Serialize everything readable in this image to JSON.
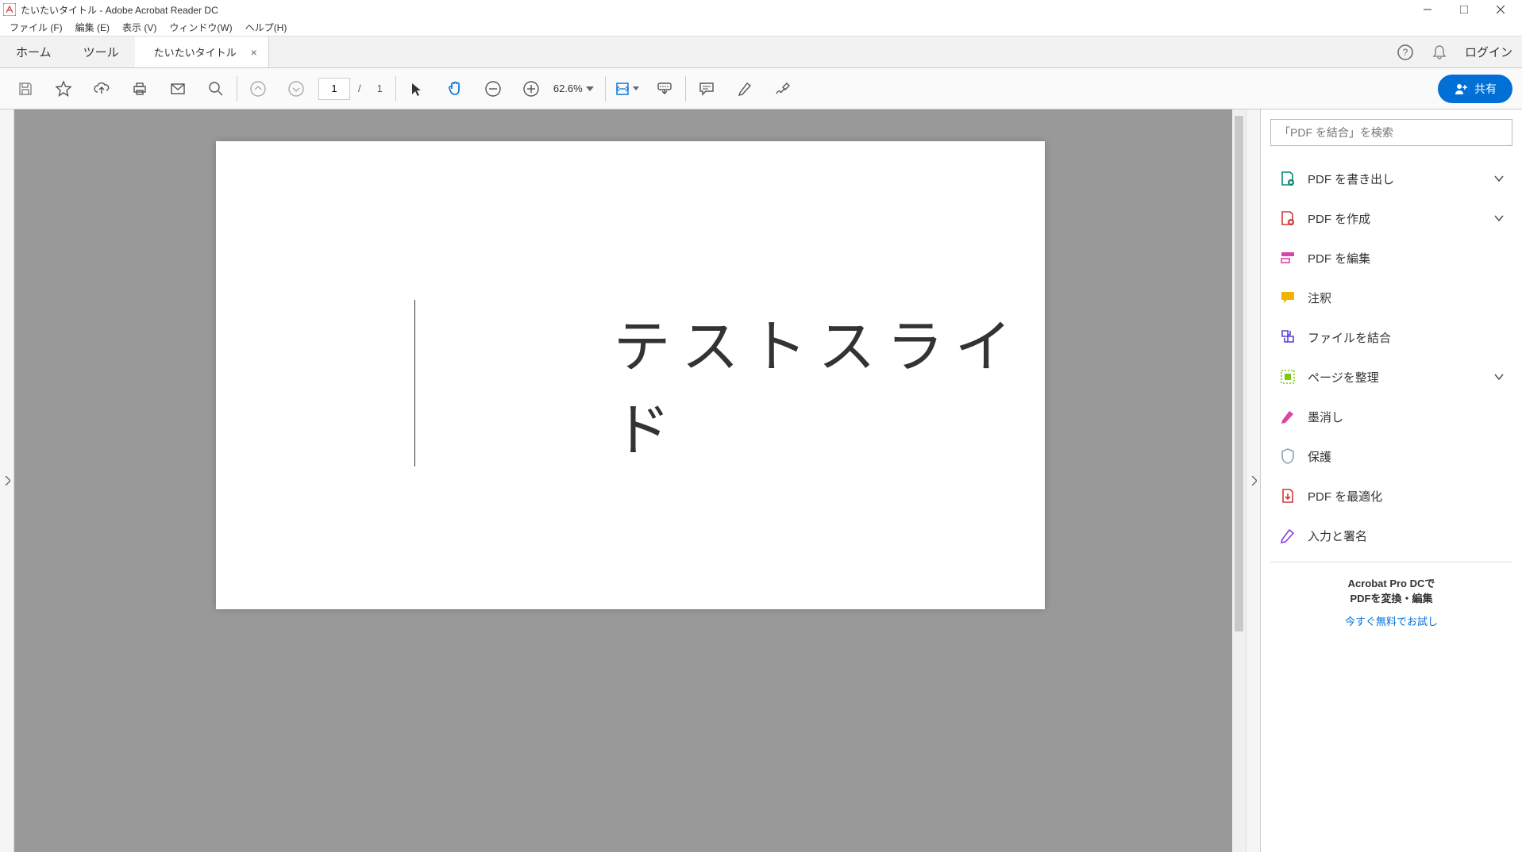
{
  "window": {
    "title": "たいたいタイトル - Adobe Acrobat Reader DC"
  },
  "menubar": {
    "file": "ファイル (F)",
    "edit": "編集 (E)",
    "view": "表示 (V)",
    "window": "ウィンドウ(W)",
    "help": "ヘルプ(H)"
  },
  "tabs": {
    "home": "ホーム",
    "tools": "ツール",
    "doc": "たいたいタイトル",
    "login": "ログイン"
  },
  "toolbar": {
    "page_current": "1",
    "page_sep": "/",
    "page_total": "1",
    "zoom": "62.6%",
    "share": "共有"
  },
  "document": {
    "slide_text": "テストスライド"
  },
  "rightpanel": {
    "search_placeholder": "「PDF を結合」を検索",
    "tools": [
      {
        "label": "PDF を書き出し",
        "chevron": true,
        "color": "#0b8a6f"
      },
      {
        "label": "PDF を作成",
        "chevron": true,
        "color": "#d03a3a"
      },
      {
        "label": "PDF を編集",
        "chevron": false,
        "color": "#d946a6"
      },
      {
        "label": "注釈",
        "chevron": false,
        "color": "#f2b200"
      },
      {
        "label": "ファイルを結合",
        "chevron": false,
        "color": "#5b3fd6"
      },
      {
        "label": "ページを整理",
        "chevron": true,
        "color": "#7ec90e"
      },
      {
        "label": "墨消し",
        "chevron": false,
        "color": "#d946a6"
      },
      {
        "label": "保護",
        "chevron": false,
        "color": "#8aa0b8"
      },
      {
        "label": "PDF を最適化",
        "chevron": false,
        "color": "#d03a3a"
      },
      {
        "label": "入力と署名",
        "chevron": false,
        "color": "#8a3fd6"
      }
    ],
    "promo_line1": "Acrobat Pro DCで",
    "promo_line2": "PDFを変換・編集",
    "promo_link": "今すぐ無料でお試し"
  }
}
